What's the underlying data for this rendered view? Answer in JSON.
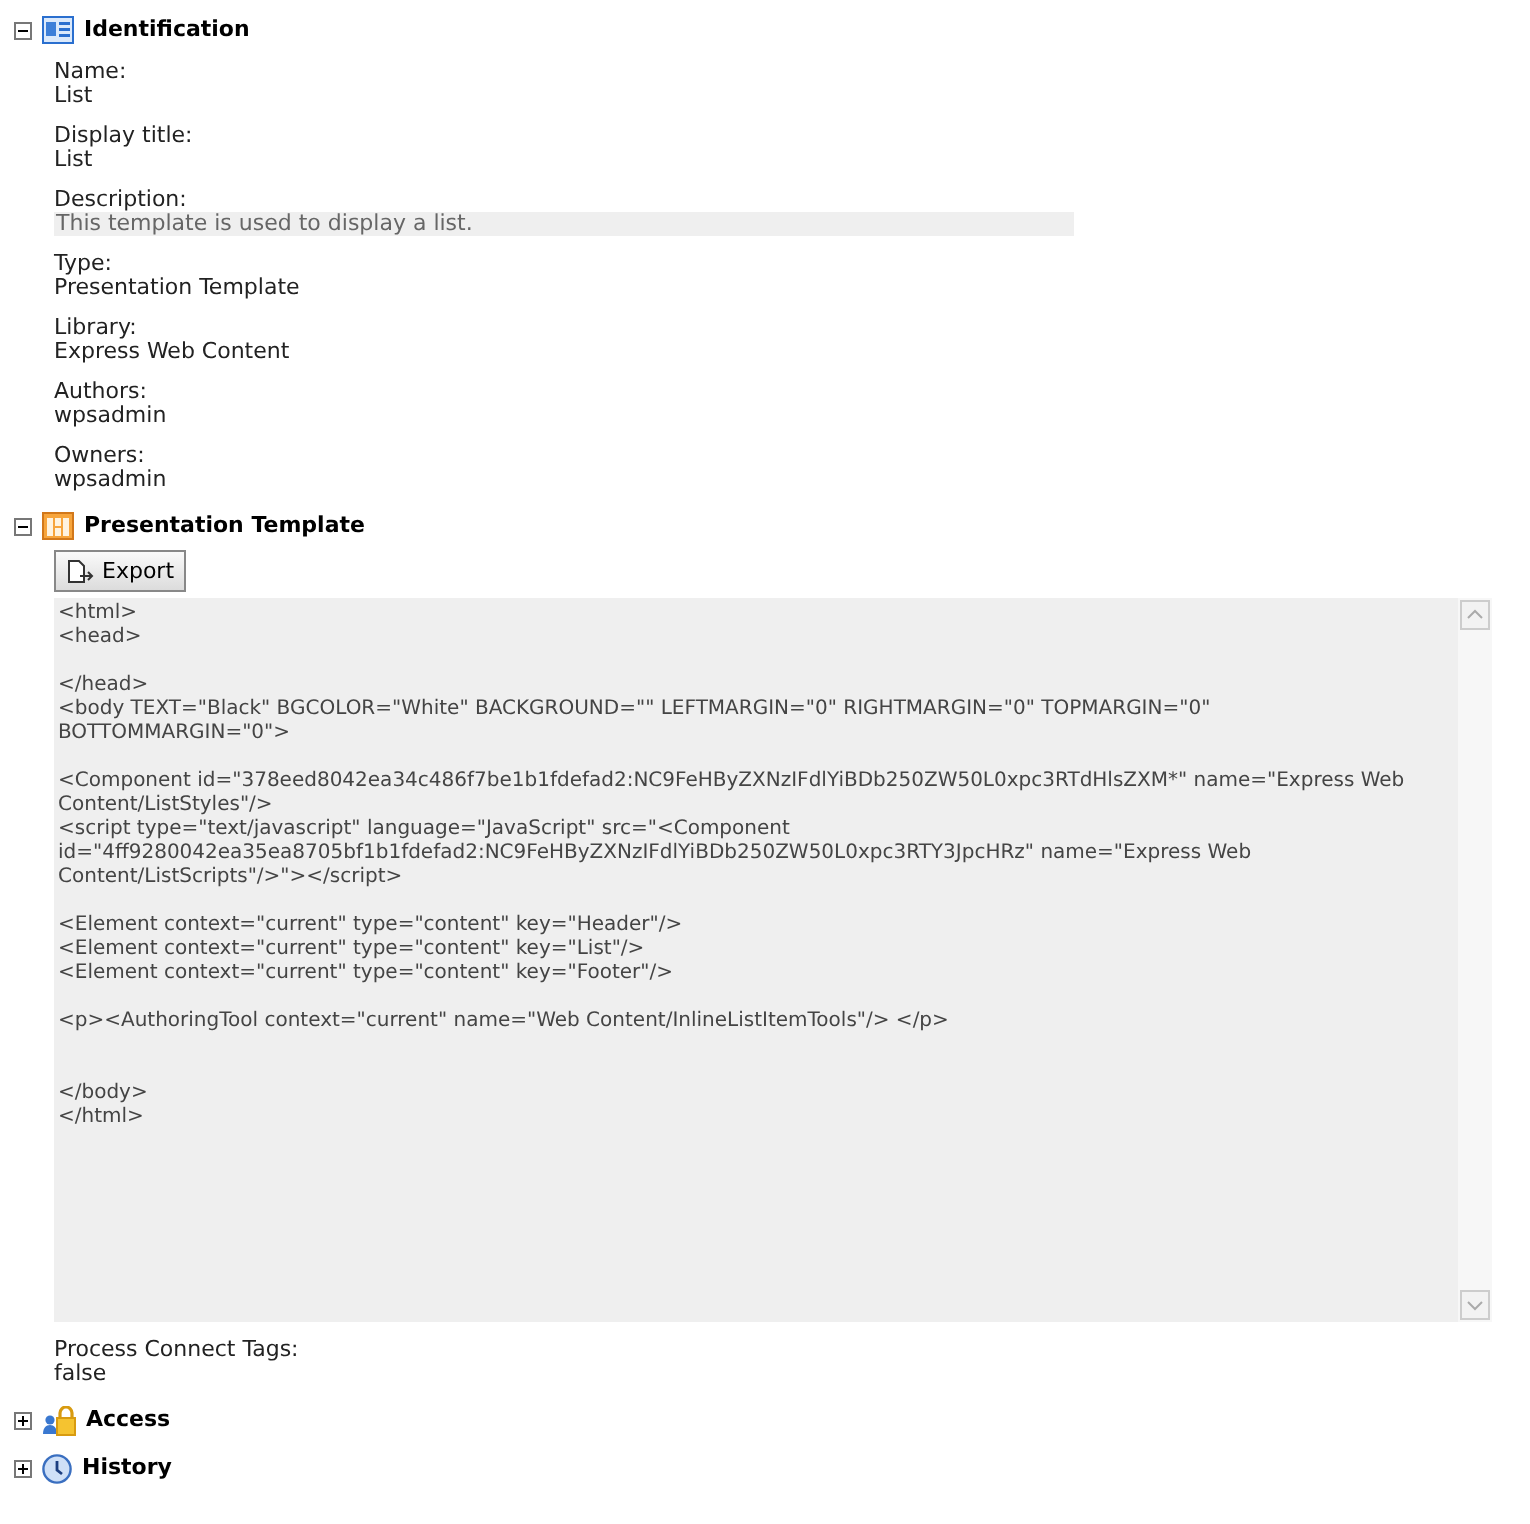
{
  "sections": [
    {
      "kind": "identification",
      "title": "Identification",
      "expanded": true,
      "fields": [
        {
          "label": "Name:",
          "value": "List"
        },
        {
          "label": "Display title:",
          "value": "List"
        },
        {
          "label": "Description:",
          "value": "This template is used to display a list.",
          "readonly": true
        },
        {
          "label": "Type:",
          "value": "Presentation Template"
        },
        {
          "label": "Library:",
          "value": "Express Web Content"
        },
        {
          "label": "Authors:",
          "value": "wpsadmin"
        },
        {
          "label": "Owners:",
          "value": "wpsadmin"
        }
      ]
    },
    {
      "kind": "template",
      "title": "Presentation Template",
      "expanded": true,
      "export_button": "Export",
      "code_lines": [
        {
          "text": "<html>"
        },
        {
          "text": "<head>"
        },
        {
          "kind": "blank"
        },
        {
          "text": "</head>"
        },
        {
          "text": "<body TEXT=\"Black\" BGCOLOR=\"White\" BACKGROUND=\"\" LEFTMARGIN=\"0\" RIGHTMARGIN=\"0\" TOPMARGIN=\"0\""
        },
        {
          "text": "BOTTOMMARGIN=\"0\">"
        },
        {
          "kind": "blank"
        },
        {
          "text": "<Component id=\"378eed8042ea34c486f7be1b1fdefad2:NC9FeHByZXNzIFdlYiBDb250ZW50L0xpc3RTdHlsZXM*\" name=\"Express Web"
        },
        {
          "text": "Content/ListStyles\"/>"
        },
        {
          "text": "<script type=\"text/javascript\" language=\"JavaScript\" src=\"<Component"
        },
        {
          "text": "id=\"4ff9280042ea35ea8705bf1b1fdefad2:NC9FeHByZXNzIFdlYiBDb250ZW50L0xpc3RTY3JpcHRz\" name=\"Express Web"
        },
        {
          "text": "Content/ListScripts\"/>\"></script>"
        },
        {
          "kind": "blank"
        },
        {
          "text": "<Element context=\"current\" type=\"content\" key=\"Header\"/>"
        },
        {
          "text": "<Element context=\"current\" type=\"content\" key=\"List\"/>"
        },
        {
          "text": "<Element context=\"current\" type=\"content\" key=\"Footer\"/>"
        },
        {
          "kind": "blank"
        },
        {
          "text": "<p><AuthoringTool context=\"current\" name=\"Web Content/InlineListItemTools\"/> </p>"
        },
        {
          "kind": "blank"
        },
        {
          "kind": "blank"
        },
        {
          "text": "</body>"
        },
        {
          "text": "</html>"
        }
      ],
      "fields": [
        {
          "label": "Process Connect Tags:",
          "value": "false"
        }
      ]
    },
    {
      "kind": "access",
      "title": "Access",
      "expanded": false
    },
    {
      "kind": "history",
      "title": "History",
      "expanded": false
    }
  ]
}
